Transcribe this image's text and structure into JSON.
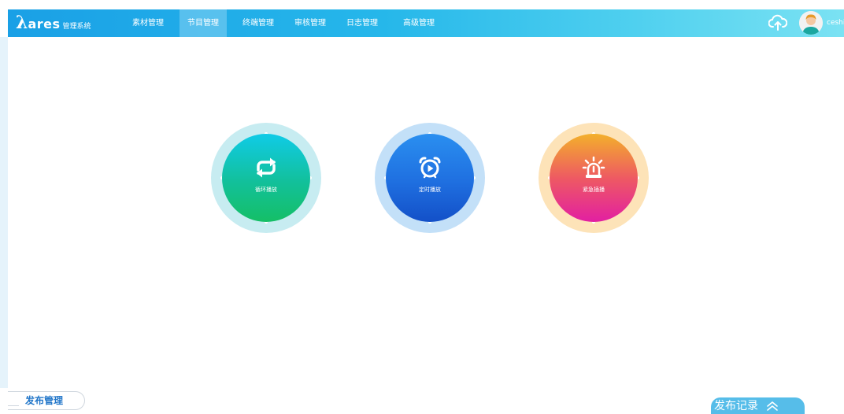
{
  "header": {
    "logo_lambda": "λ",
    "logo_name": "ares",
    "logo_subtitle": "管理系统",
    "nav": [
      {
        "label": "素材管理",
        "active": false
      },
      {
        "label": "节目管理",
        "active": true
      },
      {
        "label": "终端管理",
        "active": false
      },
      {
        "label": "审核管理",
        "active": false
      },
      {
        "label": "日志管理",
        "active": false
      },
      {
        "label": "高级管理",
        "active": false
      }
    ],
    "upload_icon": "cloud-upload-icon",
    "username": "ceshi"
  },
  "play_modes": [
    {
      "label": "循环播放",
      "icon": "loop-icon",
      "color": "#12c09a"
    },
    {
      "label": "定时播放",
      "icon": "alarm-clock-icon",
      "color": "#1f6fe0"
    },
    {
      "label": "紧急插播",
      "icon": "alarm-light-icon",
      "color": "#ee5a62"
    }
  ],
  "bottom": {
    "publish_manage_label": "发布管理",
    "publish_record_label": "发布记录",
    "expand_icon": "chevron-up-icon"
  },
  "colors": {
    "header_start": "#1aa0e6",
    "header_end": "#7be2f3",
    "accent_blue": "#2176c9"
  }
}
